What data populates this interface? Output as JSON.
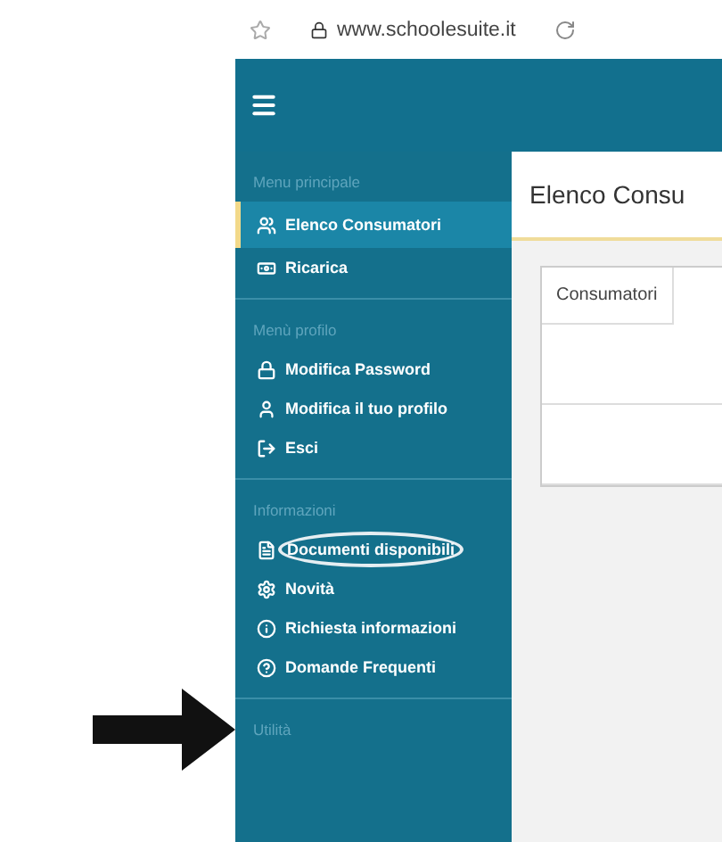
{
  "browser": {
    "url": "www.schoolesuite.it"
  },
  "sidebar": {
    "sections": [
      {
        "title": "Menu principale",
        "items": [
          {
            "label": "Elenco Consumatori",
            "selected": true,
            "circled": false
          },
          {
            "label": "Ricarica",
            "selected": false,
            "circled": false
          }
        ]
      },
      {
        "title": "Menù profilo",
        "items": [
          {
            "label": "Modifica Password",
            "selected": false,
            "circled": false
          },
          {
            "label": "Modifica il tuo profilo",
            "selected": false,
            "circled": false
          },
          {
            "label": "Esci",
            "selected": false,
            "circled": false
          }
        ]
      },
      {
        "title": "Informazioni",
        "items": [
          {
            "label": "Documenti disponibili",
            "selected": false,
            "circled": true
          },
          {
            "label": "Novità",
            "selected": false,
            "circled": false
          },
          {
            "label": "Richiesta informazioni",
            "selected": false,
            "circled": false
          },
          {
            "label": "Domande Frequenti",
            "selected": false,
            "circled": false
          }
        ]
      },
      {
        "title": "Utilità"
      }
    ]
  },
  "content": {
    "title": "Elenco Consu",
    "table": {
      "columns": [
        "Consumatori"
      ]
    }
  }
}
